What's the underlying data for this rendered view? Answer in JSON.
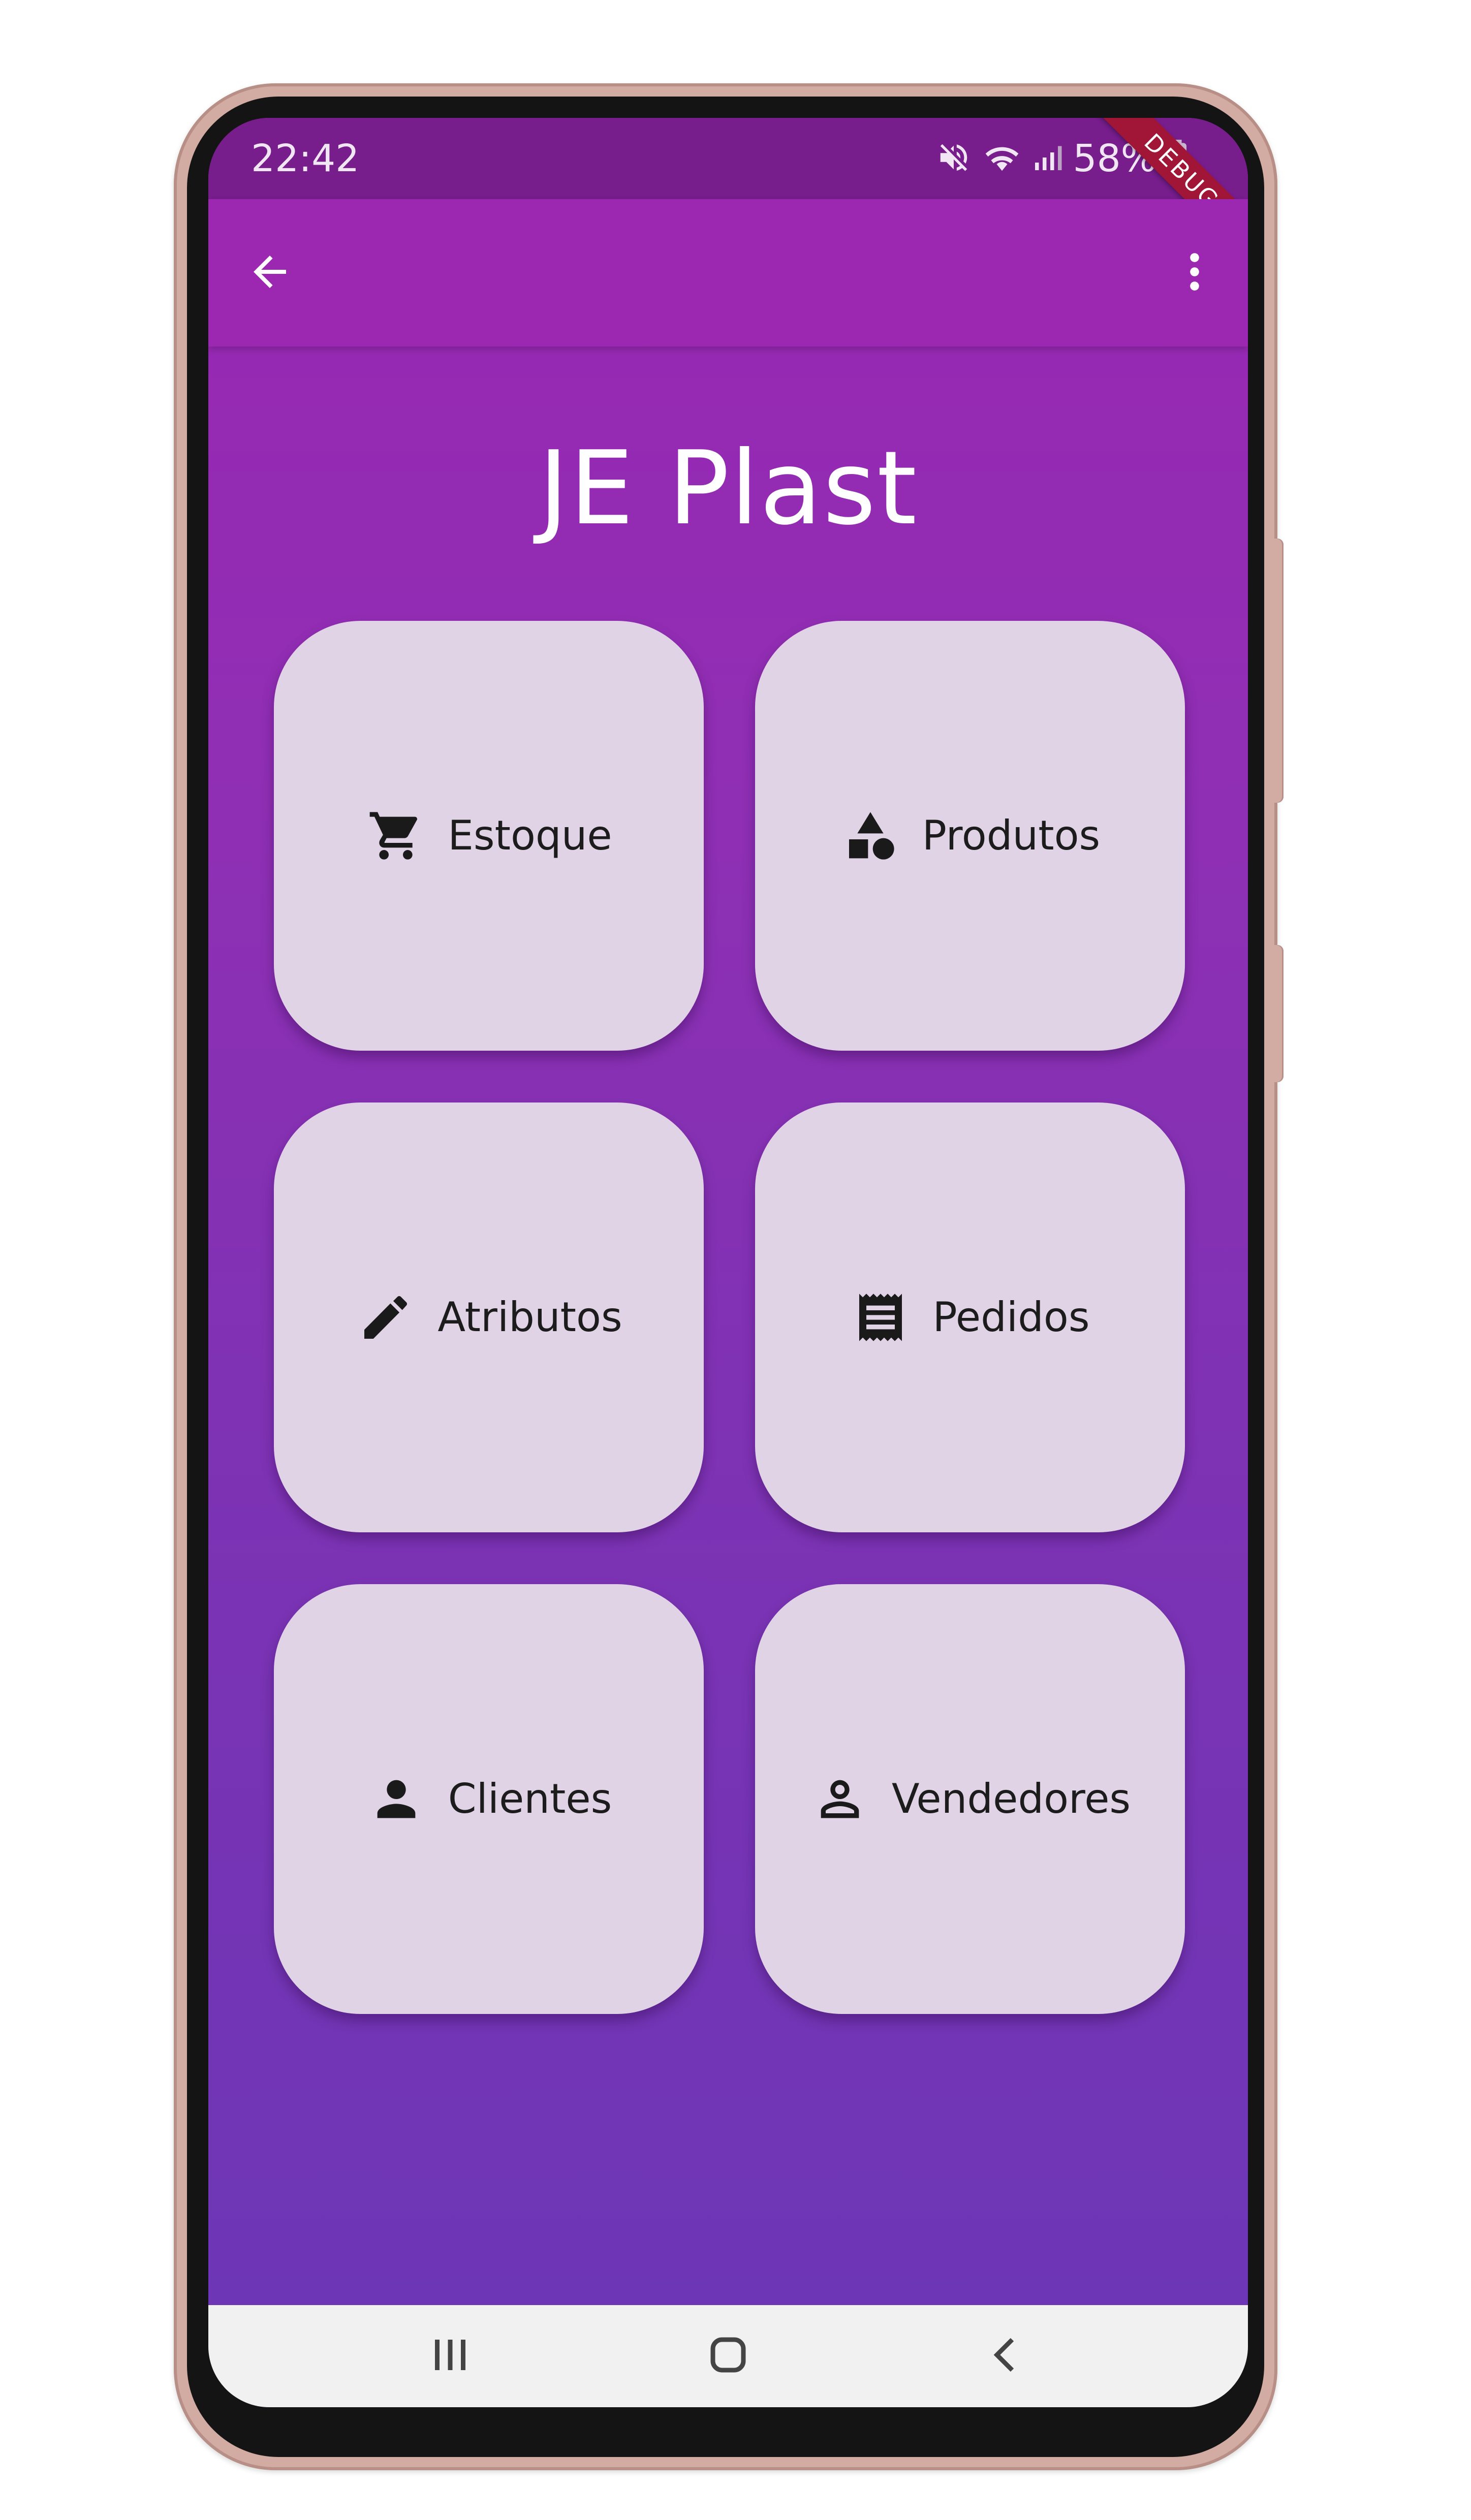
{
  "status_bar": {
    "time": "22:42",
    "battery": "58%",
    "icons": [
      "mute-icon",
      "wifi-icon",
      "signal-icon",
      "battery-icon"
    ],
    "debug_banner": "DEBUG"
  },
  "app_bar": {
    "back_icon": "arrow-back-icon",
    "menu_icon": "more-vert-icon",
    "color": "#9c27b0"
  },
  "main": {
    "title": "JE Plast",
    "tiles": [
      {
        "label": "Estoque",
        "icon": "shopping-cart-icon"
      },
      {
        "label": "Produtos",
        "icon": "category-icon"
      },
      {
        "label": "Atributos",
        "icon": "pencil-icon"
      },
      {
        "label": "Pedidos",
        "icon": "receipt-icon"
      },
      {
        "label": "Clientes",
        "icon": "person-icon"
      },
      {
        "label": "Vendedores",
        "icon": "person-outline-icon"
      }
    ],
    "tile_color": "#e1d3e6"
  },
  "nav_bar": {
    "buttons": [
      "recent-apps-icon",
      "home-icon",
      "back-icon"
    ]
  }
}
